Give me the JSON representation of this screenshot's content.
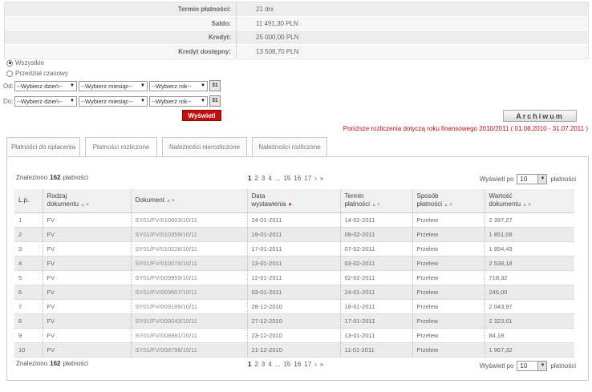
{
  "summary": [
    {
      "label": "Termin płatności:",
      "value": "21 dni"
    },
    {
      "label": "Saldo:",
      "value": "11 491,30 PLN"
    },
    {
      "label": "Kredyt:",
      "value": "25 000,00 PLN"
    },
    {
      "label": "Kredyt dostępny:",
      "value": "13 508,70 PLN"
    }
  ],
  "filter": {
    "radio_all": "Wszystkie",
    "radio_range": "Przedział czasowy",
    "from_label": "Od:",
    "to_label": "Do:",
    "day_placeholder": "--Wybierz dzień--",
    "month_placeholder": "--Wybierz miesiąc--",
    "year_placeholder": "--Wybierz rok--",
    "calendar_glyph": "31",
    "show_button": "Wyświetl"
  },
  "archive_button": "Archiwum",
  "note": "Poniższe rozliczenia dotyczą roku finansowego 2010/2011 ( 01.08.2010 - 31.07.2011 )",
  "tabs": [
    "Płatności do opłacenia",
    "Płatności rozliczone",
    "Należności nierozliczone",
    "Należności rozliczone"
  ],
  "found": {
    "prefix": "Znaleziono",
    "count": "162",
    "suffix": "płatności"
  },
  "pager": {
    "pages": [
      "1",
      "2",
      "3",
      "4",
      "...",
      "15",
      "16",
      "17"
    ],
    "next": "›",
    "last": "»"
  },
  "perpage": {
    "label": "Wyświetl po",
    "value": "10",
    "suffix": "płatności"
  },
  "columns": [
    {
      "l1": "L.p.",
      "l2": ""
    },
    {
      "l1": "Rodzaj",
      "l2": "dokumentu"
    },
    {
      "l1": "Dokument",
      "l2": ""
    },
    {
      "l1": "Data",
      "l2": "wystawienia"
    },
    {
      "l1": "Termin",
      "l2": "płatności"
    },
    {
      "l1": "Sposób",
      "l2": "płatności"
    },
    {
      "l1": "Wartość",
      "l2": "dokumentu"
    }
  ],
  "rows": [
    [
      "1",
      "FV",
      "SY01/FV/010603/10/11",
      "24-01-2011",
      "14-02-2011",
      "Przelew",
      "2 397,27"
    ],
    [
      "2",
      "FV",
      "SY01/FV/010359/10/11",
      "19-01-2011",
      "09-02-2011",
      "Przelew",
      "1 851,08"
    ],
    [
      "3",
      "FV",
      "SY01/FV/010226/10/11",
      "17-01-2011",
      "07-02-2011",
      "Przelew",
      "1 954,43"
    ],
    [
      "4",
      "FV",
      "SY01/FV/010076/10/11",
      "13-01-2011",
      "03-02-2011",
      "Przelew",
      "2 538,18"
    ],
    [
      "5",
      "FV",
      "SY01/FV/009959/10/11",
      "12-01-2011",
      "02-02-2011",
      "Przelew",
      "718,32"
    ],
    [
      "6",
      "FV",
      "SY01/FV/009507/10/11",
      "03-01-2011",
      "24-01-2011",
      "Przelew",
      "246,00"
    ],
    [
      "7",
      "FV",
      "SY01/FV/009189/10/11",
      "28-12-2010",
      "18-01-2011",
      "Przelew",
      "2 043,97"
    ],
    [
      "8",
      "FV",
      "SY01/FV/009043/10/11",
      "27-12-2010",
      "17-01-2011",
      "Przelew",
      "2 323,01"
    ],
    [
      "9",
      "FV",
      "SY01/FV/008981/10/11",
      "23-12-2010",
      "13-01-2011",
      "Przelew",
      "84,18"
    ],
    [
      "10",
      "FV",
      "SY01/FV/008798/10/11",
      "21-12-2010",
      "11-01-2011",
      "Przelew",
      "1 967,32"
    ]
  ]
}
